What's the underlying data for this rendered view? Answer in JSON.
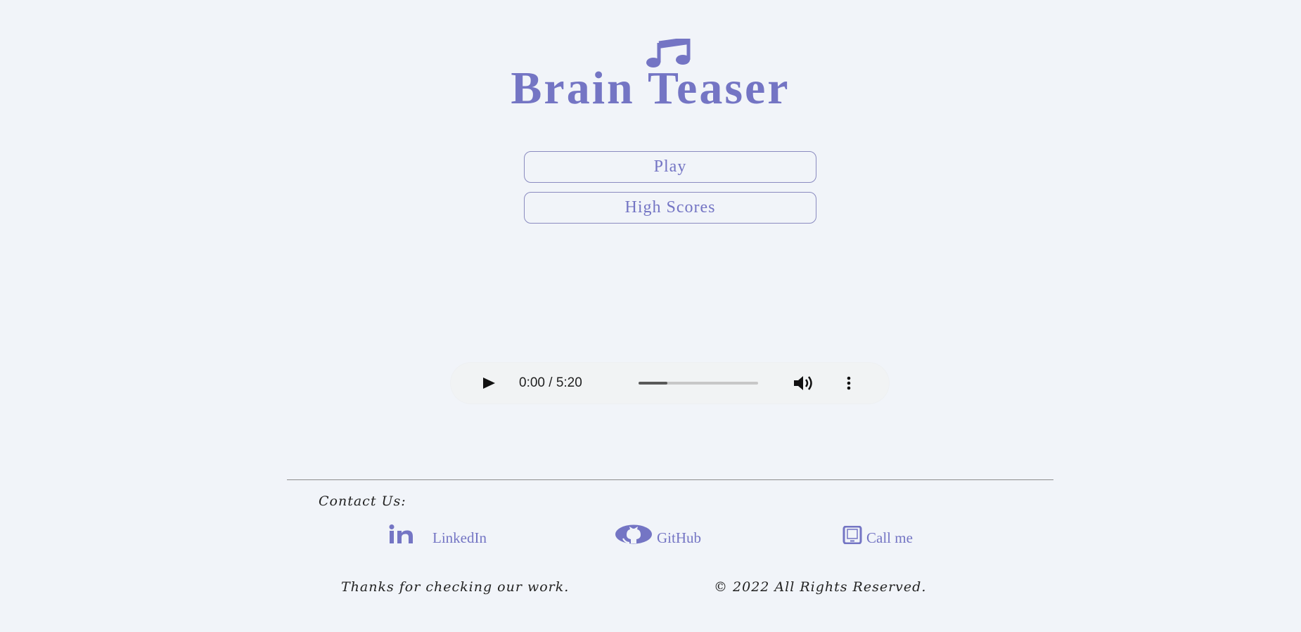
{
  "header": {
    "logo_icon": "music-note-icon",
    "title": "Brain Teaser",
    "accent_color": "#7475c4"
  },
  "menu": {
    "play_label": "Play",
    "high_scores_label": "High Scores"
  },
  "audio_player": {
    "play_icon": "play-icon",
    "time_display": "0:00 / 5:20",
    "progress_fraction": 0.24,
    "volume_icon": "volume-icon",
    "more_icon": "more-vertical-icon"
  },
  "footer": {
    "contact_label": "Contact Us:",
    "links": [
      {
        "icon": "linkedin-icon",
        "label": "LinkedIn"
      },
      {
        "icon": "github-icon",
        "label": "GitHub"
      },
      {
        "icon": "phone-icon",
        "label": "Call me"
      }
    ],
    "thanks_text": "Thanks for checking our work.",
    "copyright_text": "© 2022 All Rights Reserved."
  }
}
